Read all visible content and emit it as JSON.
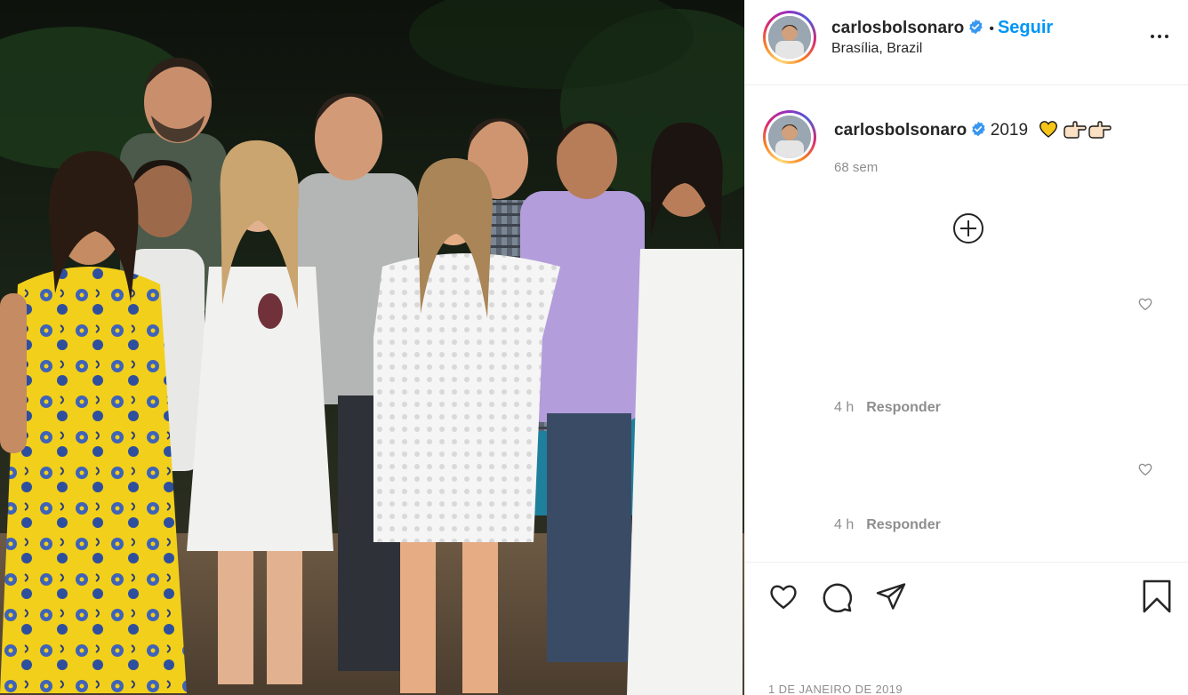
{
  "post": {
    "image_alt": "Group photo of nine people at night",
    "colors": {
      "verified": "#3897f0",
      "link": "#0095f6",
      "muted": "#8e8e8e",
      "text": "#262626"
    }
  },
  "header": {
    "username": "carlosbolsonaro",
    "separator": "•",
    "follow_label": "Seguir",
    "location": "Brasília, Brazil",
    "more_icon": "more-options-icon"
  },
  "caption": {
    "username": "carlosbolsonaro",
    "text": "2019",
    "emojis": [
      "yellow-heart",
      "pointing-right",
      "pointing-right"
    ],
    "time_ago": "68 sem"
  },
  "load_more_icon": "plus-circle-icon",
  "comments": [
    {
      "time": "4 h",
      "reply_label": "Responder"
    },
    {
      "time": "4 h",
      "reply_label": "Responder"
    }
  ],
  "actions": {
    "icons": [
      "heart-icon",
      "comment-icon",
      "share-icon",
      "bookmark-icon"
    ],
    "date": "1 DE JANEIRO DE 2019"
  }
}
